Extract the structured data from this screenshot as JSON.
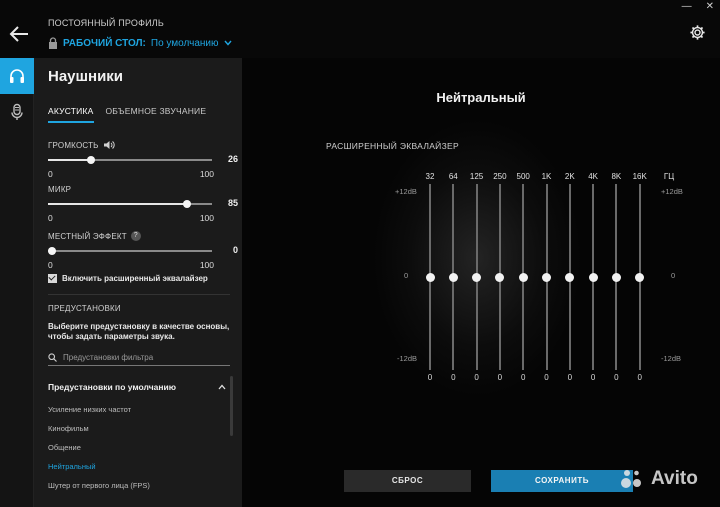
{
  "header": {
    "profile_caption": "ПОСТОЯННЫЙ ПРОФИЛЬ",
    "profile_name": "РАБОЧИЙ СТОЛ:",
    "profile_value": "По умолчанию"
  },
  "window": {
    "minimize": "—",
    "close": "✕"
  },
  "panel": {
    "title": "Наушники",
    "tabs": [
      {
        "label": "АКУСТИКА",
        "active": true
      },
      {
        "label": "ОБЪЕМНОЕ ЗВУЧАНИЕ",
        "active": false
      }
    ],
    "volume": {
      "label": "ГРОМКОСТЬ",
      "value": "26",
      "min": "0",
      "max": "100"
    },
    "mic": {
      "label": "МИКР",
      "value": "85",
      "min": "0",
      "max": "100"
    },
    "sidetone": {
      "label": "МЕСТНЫЙ ЭФФЕКТ",
      "help": "?",
      "value": "0",
      "min": "0",
      "max": "100"
    },
    "advanced_eq": {
      "label": "Включить расширенный эквалайзер",
      "checked": true
    },
    "presets": {
      "heading": "ПРЕДУСТАНОВКИ",
      "description": "Выберите предустановку в качестве основы, чтобы задать параметры звука.",
      "search_placeholder": "Предустановки фильтра",
      "group_title": "Предустановки по умолчанию",
      "items": [
        {
          "label": "Усиление низких частот",
          "active": false
        },
        {
          "label": "Кинофильм",
          "active": false
        },
        {
          "label": "Общение",
          "active": false
        },
        {
          "label": "Нейтральный",
          "active": true
        },
        {
          "label": "Шутер от первого лица (FPS)",
          "active": false
        }
      ]
    }
  },
  "main": {
    "title": "Нейтральный",
    "eq_title": "РАСШИРЕННЫЙ ЭКВАЛАЙЗЕР",
    "unit": "ГЦ",
    "db_top": "+12dB",
    "db_mid": "0",
    "db_bottom": "-12dB",
    "bands": [
      {
        "label": "32",
        "value": "0"
      },
      {
        "label": "64",
        "value": "0"
      },
      {
        "label": "125",
        "value": "0"
      },
      {
        "label": "250",
        "value": "0"
      },
      {
        "label": "500",
        "value": "0"
      },
      {
        "label": "1K",
        "value": "0"
      },
      {
        "label": "2K",
        "value": "0"
      },
      {
        "label": "4K",
        "value": "0"
      },
      {
        "label": "8K",
        "value": "0"
      },
      {
        "label": "16K",
        "value": "0"
      }
    ],
    "reset_label": "СБРОС",
    "save_label": "СОХРАНИТЬ"
  },
  "watermark": {
    "text": "Avito"
  },
  "colors": {
    "accent": "#1fa5e0",
    "save": "#1a7fb3"
  },
  "icons": [
    "back-arrow-icon",
    "lock-icon",
    "chevron-down-icon",
    "gear-icon",
    "headphones-icon",
    "microphone-icon",
    "speaker-icon",
    "search-icon",
    "chevron-up-icon"
  ]
}
